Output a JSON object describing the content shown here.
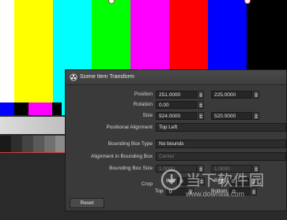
{
  "colors": {
    "bars": [
      "#ffffff",
      "#ffff00",
      "#00ffff",
      "#00ff00",
      "#ff00ff",
      "#ff0000",
      "#0000ff",
      "#000000"
    ],
    "sub_bars": [
      "#0000ff",
      "#000000",
      "#ff00ff",
      "#000000",
      "#00ffff"
    ],
    "steps": [
      "#1a1a1a",
      "#2e2e2e",
      "#444444",
      "#5a5a5a",
      "#707070",
      "#8a8a8a"
    ],
    "dialog_bg": "#3a3a3a",
    "selection": "#d23c3c"
  },
  "dialog": {
    "title": "Scene Item Transform",
    "icon": "obs-logo-icon",
    "fields": {
      "position_label": "Position",
      "position_x": "251.0000",
      "position_y": "225.0000",
      "rotation_label": "Rotation",
      "rotation": "0.00",
      "size_label": "Size",
      "size_w": "924.0000",
      "size_h": "520.0000",
      "alignment_label": "Positional Alignment",
      "alignment_value": "Top Left",
      "bbox_type_label": "Bounding Box Type",
      "bbox_type_value": "No bounds",
      "bbox_align_label": "Alignment in Bounding Box",
      "bbox_align_value": "Center",
      "bbox_size_label": "Bounding Box Size",
      "bbox_w": "1.0000",
      "bbox_h": "1.0000",
      "crop_label": "Crop",
      "crop_left_label": "Left",
      "crop_left": "0",
      "crop_right_label": "Right",
      "crop_right": "0",
      "crop_top_label": "Top",
      "crop_top": "0",
      "crop_bottom_label": "Bottom",
      "crop_bottom": "0"
    },
    "reset_label": "Reset"
  },
  "watermark": {
    "text_cn": "当下软件园",
    "url": "www.downxia.com"
  }
}
